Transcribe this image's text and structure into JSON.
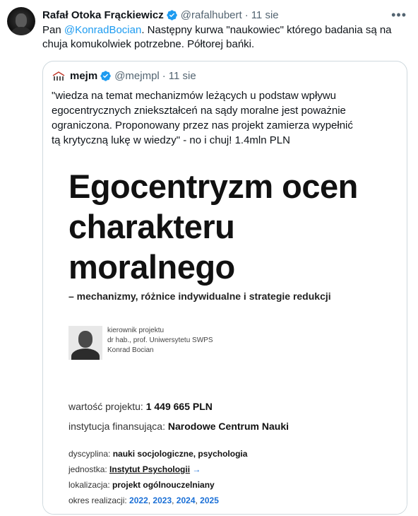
{
  "tweet": {
    "author_name": "Rafał Otoka Frąckiewicz",
    "handle": "@rafalhubert",
    "separator": "·",
    "time": "11 sie",
    "more_icon": "•••",
    "text_before": "Pan ",
    "mention": "@KonradBocian",
    "text_after": ". Następny kurwa \"naukowiec\" którego badania są na chuja komukolwiek potrzebne. Półtorej bańki."
  },
  "quote": {
    "author_name": "mejm",
    "handle": "@mejmpl",
    "separator": "·",
    "time": "11 sie",
    "text": "\"wiedza na temat mechanizmów leżących u podstaw wpływu egocentrycznych zniekształceń na sądy moralne jest poważnie ograniczona. Proponowany przez nas projekt zamierza wypełnić tą krytyczną lukę w wiedzy\" - no i chuj! 1.4mln PLN"
  },
  "card": {
    "title_lines": [
      "Egocentryzm ocen",
      "charakteru",
      "moralnego"
    ],
    "subtitle": "– mechanizmy, różnice indywidualne i strategie redukcji",
    "leader_role": "kierownik projektu",
    "leader_title": "dr hab., prof. Uniwersytetu SWPS",
    "leader_name": "Konrad Bocian",
    "value_label": "wartość projektu:",
    "value": "1 449 665 PLN",
    "institution_label": "instytucja finansująca:",
    "institution": "Narodowe Centrum Nauki",
    "discipline_label": "dyscyplina:",
    "discipline": "nauki socjologiczne, psychologia",
    "unit_label": "jednostka:",
    "unit": "Instytut Psychologii",
    "unit_arrow": "→",
    "location_label": "lokalizacja:",
    "location": "projekt ogólnouczelniany",
    "period_label": "okres realizacji:",
    "years": [
      "2022",
      "2023",
      "2024",
      "2025"
    ],
    "years_sep": ", "
  },
  "colors": {
    "link": "#1d9bf0",
    "verified": "#1d9bf0",
    "year_blue": "#1a6fd6",
    "border": "#cfd9de",
    "muted": "#536471"
  }
}
